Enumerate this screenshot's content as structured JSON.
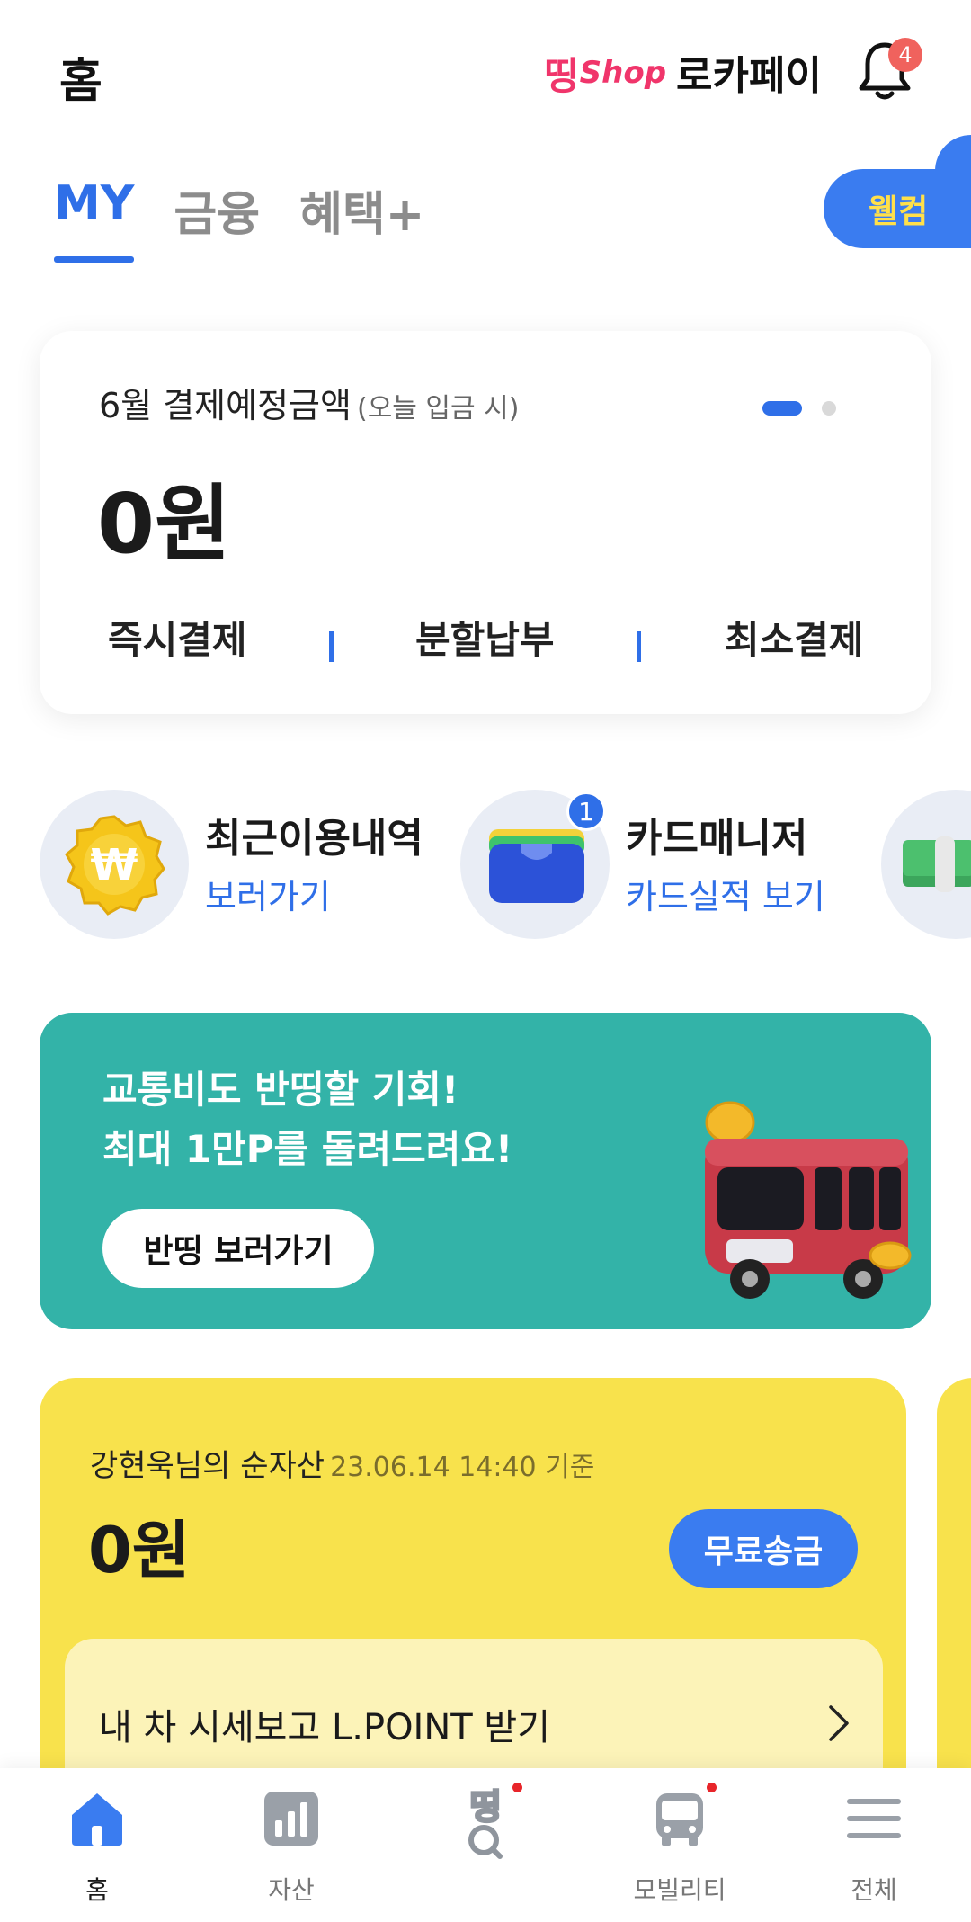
{
  "header": {
    "title": "홈",
    "shop_logo_prefix": "띵",
    "shop_logo_text": "Shop",
    "pay_label": "로카페이",
    "notification_count": "4"
  },
  "tabs": [
    {
      "label": "MY",
      "active": true
    },
    {
      "label": "금융",
      "active": false
    },
    {
      "label": "혜택+",
      "active": false
    }
  ],
  "welcome_label": "웰컴",
  "payment_card": {
    "label": "6월 결제예정금액",
    "label_sub": "(오늘 입금 시)",
    "amount": "0원",
    "actions": [
      "즉시결제",
      "분할납부",
      "최소결제"
    ],
    "page_index": 1,
    "page_count": 2
  },
  "shortcuts": [
    {
      "title": "최근이용내역",
      "subtitle": "보러가기",
      "icon": "won-coin-icon"
    },
    {
      "title": "카드매니저",
      "subtitle": "카드실적 보기",
      "icon": "wallet-icon",
      "badge": "1"
    }
  ],
  "promo": {
    "line1": "교통비도 반띵할 기회!",
    "line2": "최대 1만P를 돌려드려요!",
    "button": "반띵 보러가기",
    "accent": "#33b3a8"
  },
  "asset_card": {
    "title": "강현욱님의 순자산",
    "timestamp": "23.06.14 14:40 기준",
    "amount": "0원",
    "transfer_button": "무료송금",
    "car_row_text": "내 차 시세보고 L.POINT 받기"
  },
  "bottom_nav": [
    {
      "label": "홈",
      "icon": "home-icon",
      "active": true
    },
    {
      "label": "자산",
      "icon": "bar-chart-icon",
      "active": false
    },
    {
      "label": "",
      "icon": "ddeng-search-icon",
      "active": false,
      "dot": true
    },
    {
      "label": "모빌리티",
      "icon": "bus-icon",
      "active": false,
      "dot": true
    },
    {
      "label": "전체",
      "icon": "menu-icon",
      "active": false
    }
  ],
  "colors": {
    "primary": "#2f6fe8",
    "shop_pink": "#f0356b",
    "badge_red": "#f0625d",
    "asset_yellow": "#f8e24c"
  }
}
